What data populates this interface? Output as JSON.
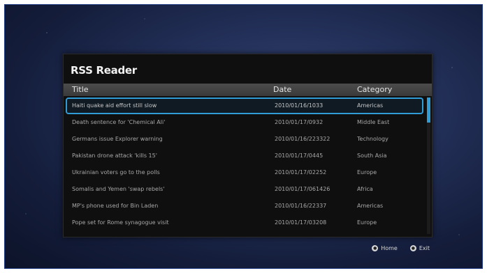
{
  "app": {
    "title": "RSS Reader"
  },
  "table": {
    "columns": {
      "title": "Title",
      "date": "Date",
      "category": "Category"
    },
    "rows": [
      {
        "title": "Haiti quake aid effort still slow",
        "date": "2010/01/16/1033",
        "category": "Americas"
      },
      {
        "title": "Death sentence for 'Chemical Ali'",
        "date": "2010/01/17/0932",
        "category": "Middle East"
      },
      {
        "title": "Germans issue Explorer warning",
        "date": "2010/01/16/223322",
        "category": "Technology"
      },
      {
        "title": "Pakistan drone attack 'kills 15'",
        "date": "2010/01/17/0445",
        "category": "South Asia"
      },
      {
        "title": "Ukrainian voters go to the polls",
        "date": "2010/01/17/02252",
        "category": "Europe"
      },
      {
        "title": "Somalis and Yemen 'swap rebels'",
        "date": "2010/01/17/061426",
        "category": "Africa"
      },
      {
        "title": "MP's phone used for Bin Laden",
        "date": "2010/01/16/22337",
        "category": "Americas"
      },
      {
        "title": "Pope set for Rome synagogue visit",
        "date": "2010/01/17/03208",
        "category": "Europe"
      }
    ],
    "selected_index": 0
  },
  "footer": {
    "home_label": "Home",
    "exit_label": "Exit",
    "home_icon": "home-button-icon",
    "exit_icon": "exit-button-icon"
  },
  "colors": {
    "accent": "#2f9cd6"
  }
}
